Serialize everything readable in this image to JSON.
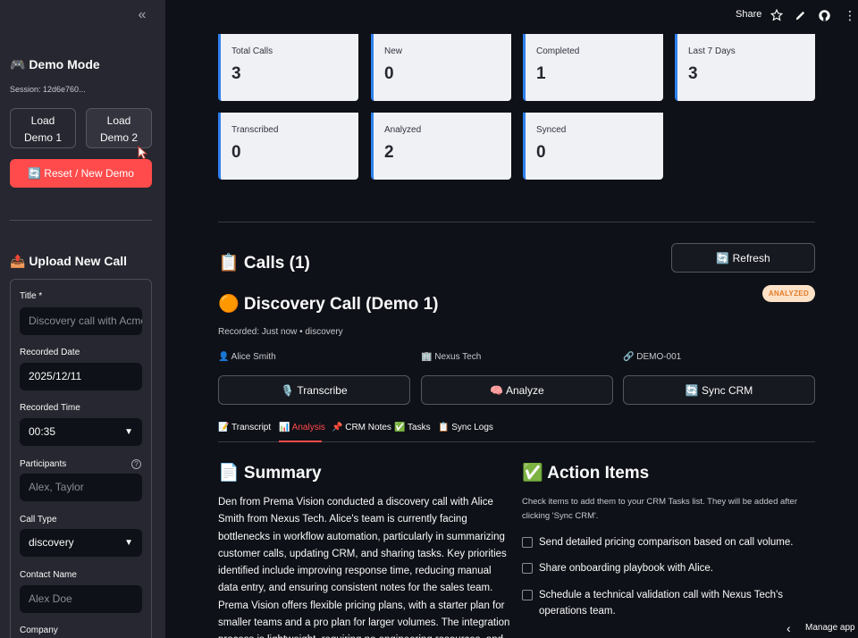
{
  "sidebar": {
    "collapse_icon": "«",
    "demo_mode_title": "🎮 Demo Mode",
    "session": "Session: 12d6e760...",
    "load_demo1": [
      "Load",
      "Demo 1"
    ],
    "load_demo2": [
      "Load",
      "Demo 2"
    ],
    "reset_label": "🔄 Reset / New Demo",
    "upload_title": "📤 Upload New Call",
    "form": {
      "title_label": "Title *",
      "title_placeholder": "Discovery call with Acme",
      "recorded_date_label": "Recorded Date",
      "recorded_date_value": "2025/12/11",
      "recorded_time_label": "Recorded Time",
      "recorded_time_value": "00:35",
      "participants_label": "Participants",
      "participants_placeholder": "Alex, Taylor",
      "call_type_label": "Call Type",
      "call_type_value": "discovery",
      "contact_name_label": "Contact Name",
      "contact_name_placeholder": "Alex Doe",
      "company_label": "Company"
    }
  },
  "topbar": {
    "share": "Share"
  },
  "metrics": [
    {
      "label": "Total Calls",
      "value": "3"
    },
    {
      "label": "New",
      "value": "0"
    },
    {
      "label": "Completed",
      "value": "1"
    },
    {
      "label": "Last 7 Days",
      "value": "3"
    },
    {
      "label": "Transcribed",
      "value": "0"
    },
    {
      "label": "Analyzed",
      "value": "2"
    },
    {
      "label": "Synced",
      "value": "0"
    }
  ],
  "calls": {
    "title": "📋 Calls (1)",
    "refresh_label": "🔄 Refresh",
    "call_title": "🟠 Discovery Call (Demo 1)",
    "status_badge": "ANALYZED",
    "recorded": "Recorded: Just now • discovery",
    "contact": "👤 Alice Smith",
    "company": "🏢 Nexus Tech",
    "crm_id": "🔗 DEMO-001",
    "transcribe_label": "🎙️ Transcribe",
    "analyze_label": "🧠 Analyze",
    "sync_label": "🔄 Sync CRM"
  },
  "tabs": [
    {
      "label": "📝 Transcript"
    },
    {
      "label": "📊 Analysis"
    },
    {
      "label": "📌 CRM Notes"
    },
    {
      "label": "✅ Tasks"
    },
    {
      "label": "📋 Sync Logs"
    }
  ],
  "summary": {
    "title": "📄 Summary",
    "text": "Den from Prema Vision conducted a discovery call with Alice Smith from Nexus Tech. Alice's team is currently facing bottlenecks in workflow automation, particularly in summarizing customer calls, updating CRM, and sharing tasks. Key priorities identified include improving response time, reducing manual data entry, and ensuring consistent notes for the sales team. Prema Vision offers flexible pricing plans, with a starter plan for smaller teams and a pro plan for larger volumes. The integration process is lightweight, requiring no engineering resources, and onboarding typically"
  },
  "action_items": {
    "title": "✅ Action Items",
    "note": "Check items to add them to your CRM Tasks list. They will be added after clicking 'Sync CRM'.",
    "items": [
      "Send detailed pricing comparison based on call volume.",
      "Share onboarding playbook with Alice.",
      "Schedule a technical validation call with Nexus Tech's operations team."
    ]
  },
  "footer": {
    "manage_app": "Manage app"
  }
}
